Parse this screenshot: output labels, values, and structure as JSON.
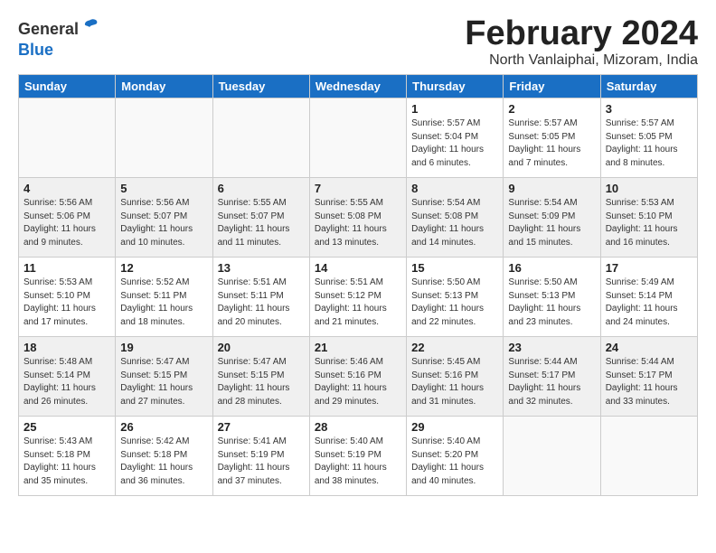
{
  "logo": {
    "general": "General",
    "blue": "Blue"
  },
  "title": "February 2024",
  "location": "North Vanlaiphai, Mizoram, India",
  "weekdays": [
    "Sunday",
    "Monday",
    "Tuesday",
    "Wednesday",
    "Thursday",
    "Friday",
    "Saturday"
  ],
  "weeks": [
    [
      {
        "day": "",
        "info": ""
      },
      {
        "day": "",
        "info": ""
      },
      {
        "day": "",
        "info": ""
      },
      {
        "day": "",
        "info": ""
      },
      {
        "day": "1",
        "info": "Sunrise: 5:57 AM\nSunset: 5:04 PM\nDaylight: 11 hours\nand 6 minutes."
      },
      {
        "day": "2",
        "info": "Sunrise: 5:57 AM\nSunset: 5:05 PM\nDaylight: 11 hours\nand 7 minutes."
      },
      {
        "day": "3",
        "info": "Sunrise: 5:57 AM\nSunset: 5:05 PM\nDaylight: 11 hours\nand 8 minutes."
      }
    ],
    [
      {
        "day": "4",
        "info": "Sunrise: 5:56 AM\nSunset: 5:06 PM\nDaylight: 11 hours\nand 9 minutes."
      },
      {
        "day": "5",
        "info": "Sunrise: 5:56 AM\nSunset: 5:07 PM\nDaylight: 11 hours\nand 10 minutes."
      },
      {
        "day": "6",
        "info": "Sunrise: 5:55 AM\nSunset: 5:07 PM\nDaylight: 11 hours\nand 11 minutes."
      },
      {
        "day": "7",
        "info": "Sunrise: 5:55 AM\nSunset: 5:08 PM\nDaylight: 11 hours\nand 13 minutes."
      },
      {
        "day": "8",
        "info": "Sunrise: 5:54 AM\nSunset: 5:08 PM\nDaylight: 11 hours\nand 14 minutes."
      },
      {
        "day": "9",
        "info": "Sunrise: 5:54 AM\nSunset: 5:09 PM\nDaylight: 11 hours\nand 15 minutes."
      },
      {
        "day": "10",
        "info": "Sunrise: 5:53 AM\nSunset: 5:10 PM\nDaylight: 11 hours\nand 16 minutes."
      }
    ],
    [
      {
        "day": "11",
        "info": "Sunrise: 5:53 AM\nSunset: 5:10 PM\nDaylight: 11 hours\nand 17 minutes."
      },
      {
        "day": "12",
        "info": "Sunrise: 5:52 AM\nSunset: 5:11 PM\nDaylight: 11 hours\nand 18 minutes."
      },
      {
        "day": "13",
        "info": "Sunrise: 5:51 AM\nSunset: 5:11 PM\nDaylight: 11 hours\nand 20 minutes."
      },
      {
        "day": "14",
        "info": "Sunrise: 5:51 AM\nSunset: 5:12 PM\nDaylight: 11 hours\nand 21 minutes."
      },
      {
        "day": "15",
        "info": "Sunrise: 5:50 AM\nSunset: 5:13 PM\nDaylight: 11 hours\nand 22 minutes."
      },
      {
        "day": "16",
        "info": "Sunrise: 5:50 AM\nSunset: 5:13 PM\nDaylight: 11 hours\nand 23 minutes."
      },
      {
        "day": "17",
        "info": "Sunrise: 5:49 AM\nSunset: 5:14 PM\nDaylight: 11 hours\nand 24 minutes."
      }
    ],
    [
      {
        "day": "18",
        "info": "Sunrise: 5:48 AM\nSunset: 5:14 PM\nDaylight: 11 hours\nand 26 minutes."
      },
      {
        "day": "19",
        "info": "Sunrise: 5:47 AM\nSunset: 5:15 PM\nDaylight: 11 hours\nand 27 minutes."
      },
      {
        "day": "20",
        "info": "Sunrise: 5:47 AM\nSunset: 5:15 PM\nDaylight: 11 hours\nand 28 minutes."
      },
      {
        "day": "21",
        "info": "Sunrise: 5:46 AM\nSunset: 5:16 PM\nDaylight: 11 hours\nand 29 minutes."
      },
      {
        "day": "22",
        "info": "Sunrise: 5:45 AM\nSunset: 5:16 PM\nDaylight: 11 hours\nand 31 minutes."
      },
      {
        "day": "23",
        "info": "Sunrise: 5:44 AM\nSunset: 5:17 PM\nDaylight: 11 hours\nand 32 minutes."
      },
      {
        "day": "24",
        "info": "Sunrise: 5:44 AM\nSunset: 5:17 PM\nDaylight: 11 hours\nand 33 minutes."
      }
    ],
    [
      {
        "day": "25",
        "info": "Sunrise: 5:43 AM\nSunset: 5:18 PM\nDaylight: 11 hours\nand 35 minutes."
      },
      {
        "day": "26",
        "info": "Sunrise: 5:42 AM\nSunset: 5:18 PM\nDaylight: 11 hours\nand 36 minutes."
      },
      {
        "day": "27",
        "info": "Sunrise: 5:41 AM\nSunset: 5:19 PM\nDaylight: 11 hours\nand 37 minutes."
      },
      {
        "day": "28",
        "info": "Sunrise: 5:40 AM\nSunset: 5:19 PM\nDaylight: 11 hours\nand 38 minutes."
      },
      {
        "day": "29",
        "info": "Sunrise: 5:40 AM\nSunset: 5:20 PM\nDaylight: 11 hours\nand 40 minutes."
      },
      {
        "day": "",
        "info": ""
      },
      {
        "day": "",
        "info": ""
      }
    ]
  ]
}
